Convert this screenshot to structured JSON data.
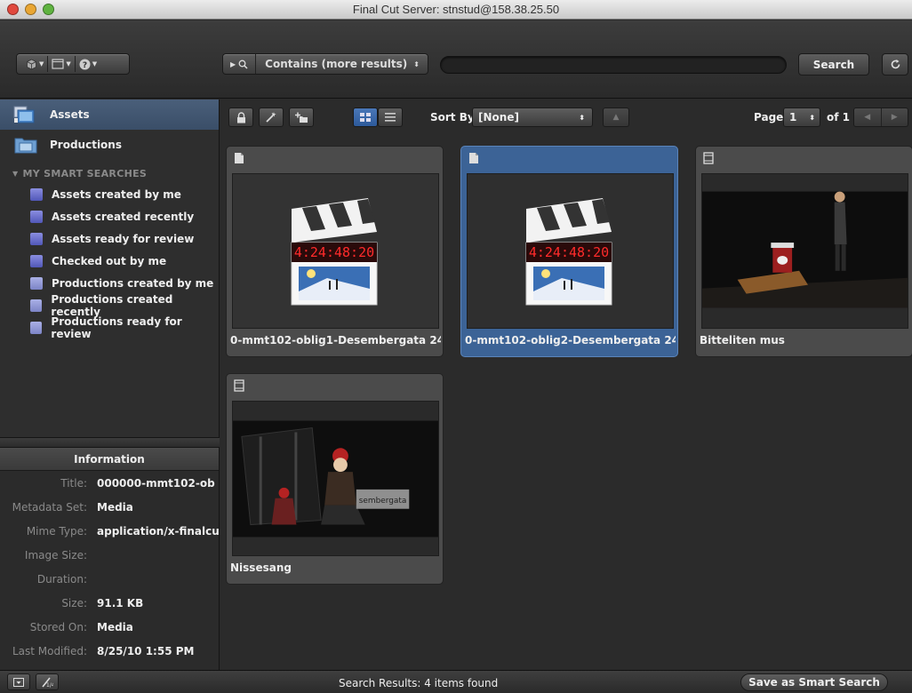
{
  "window": {
    "title": "Final Cut Server: stnstud@158.38.25.50",
    "traffic_lights": {
      "close": "#e0493e",
      "minimize": "#e9a633",
      "zoom": "#5fb340"
    }
  },
  "toolbar": {
    "search_scope_label": "Contains (more results)",
    "search_value": "",
    "search_button": "Search"
  },
  "sidebar": {
    "items": [
      {
        "label": "Assets",
        "icon": "assets-icon",
        "selected": true
      },
      {
        "label": "Productions",
        "icon": "productions-icon",
        "selected": false
      }
    ],
    "smart_searches_heading": "MY SMART SEARCHES",
    "smart_searches": [
      {
        "label": "Assets created by me",
        "icon": "asset-search-icon"
      },
      {
        "label": "Assets created recently",
        "icon": "asset-search-icon"
      },
      {
        "label": "Assets ready for review",
        "icon": "asset-search-icon"
      },
      {
        "label": "Checked out by me",
        "icon": "asset-search-icon"
      },
      {
        "label": "Productions created by me",
        "icon": "production-search-icon"
      },
      {
        "label": "Productions created recently",
        "icon": "production-search-icon"
      },
      {
        "label": "Productions ready for review",
        "icon": "production-search-icon"
      }
    ]
  },
  "info": {
    "header": "Information",
    "rows": [
      {
        "key": "Title:",
        "value": "000000-mmt102-ob"
      },
      {
        "key": "Metadata Set:",
        "value": "Media"
      },
      {
        "key": "Mime Type:",
        "value": "application/x-finalcu"
      },
      {
        "key": "Image Size:",
        "value": ""
      },
      {
        "key": "Duration:",
        "value": ""
      },
      {
        "key": "Size:",
        "value": "91.1 KB"
      },
      {
        "key": "Stored On:",
        "value": "Media"
      },
      {
        "key": "Last Modified:",
        "value": "8/25/10 1:55 PM"
      }
    ]
  },
  "content_bar": {
    "sort_by_label": "Sort By",
    "sort_value": "[None]",
    "page_label": "Page",
    "page_value": "1",
    "page_of": "of 1"
  },
  "assets": [
    {
      "name": "0-mmt102-oblig1-Desembergata 24",
      "type": "document",
      "thumb": "fcp-clapper",
      "selected": false
    },
    {
      "name": "0-mmt102-oblig2-Desembergata 24",
      "type": "document",
      "thumb": "fcp-clapper",
      "selected": true
    },
    {
      "name": "Bitteliten mus",
      "type": "video",
      "thumb": "stage-girl",
      "selected": false
    },
    {
      "name": "Nissesang",
      "type": "video",
      "thumb": "stage-santa",
      "selected": false
    }
  ],
  "fcp_counter": "4:24:48:20",
  "status_text": "Search Results: 4 items found",
  "save_smart_search": "Save as Smart Search",
  "colors": {
    "selection_blue": "#3c6396",
    "sidebar_selected": "#4a5f7a"
  }
}
